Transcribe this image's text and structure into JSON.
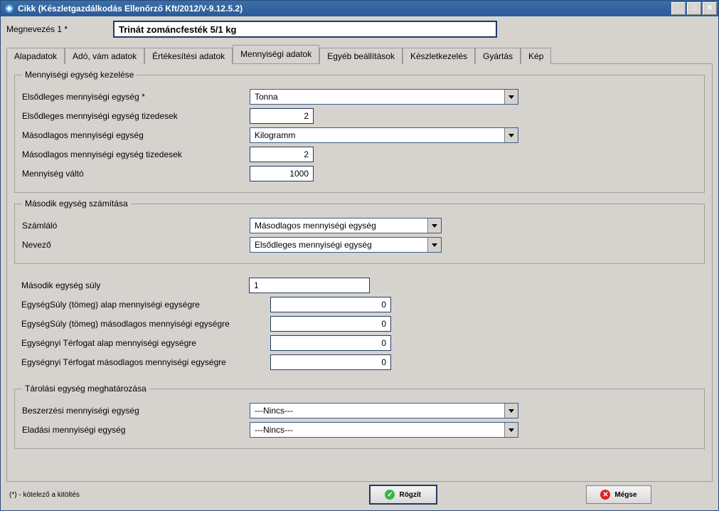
{
  "window": {
    "title": "Cikk (Készletgazdálkodás Ellenőrző Kft/2012/V-9.12.5.2)"
  },
  "header": {
    "label": "Megnevezés 1 *",
    "value": "Trinát zománcfesték 5/1 kg"
  },
  "tabs": {
    "items": [
      "Alapadatok",
      "Adó, vám adatok",
      "Értékesítési adatok",
      "Mennyiségi adatok",
      "Egyéb beállítások",
      "Készletkezelés",
      "Gyártás",
      "Kép"
    ],
    "active_index": 3
  },
  "group_unit": {
    "legend": "Mennyiségi egység kezelése",
    "primary_unit_label": "Elsődleges mennyiségi egység *",
    "primary_unit_value": "Tonna",
    "primary_dec_label": "Elsődleges mennyiségi egység tizedesek",
    "primary_dec_value": "2",
    "secondary_unit_label": "Másodlagos mennyiségi egység",
    "secondary_unit_value": "Kilogramm",
    "secondary_dec_label": "Másodlagos mennyiségi egység tizedesek",
    "secondary_dec_value": "2",
    "ratio_label": "Mennyiség váltó",
    "ratio_value": "1000"
  },
  "group_calc": {
    "legend": "Második egység számítása",
    "numerator_label": "Számláló",
    "numerator_value": "Másodlagos mennyiségi egység",
    "denominator_label": "Nevező",
    "denominator_value": "Elsődleges mennyiségi egység"
  },
  "weights": {
    "second_weight_label": "Második egység súly",
    "second_weight_value": "1",
    "uw_base_label": "EgységSúly (tömeg) alap mennyiségi egységre",
    "uw_base_value": "0",
    "uw_sec_label": "EgységSúly (tömeg) másodlagos mennyiségi egységre",
    "uw_sec_value": "0",
    "uv_base_label": "Egységnyi Térfogat alap mennyiségi egységre",
    "uv_base_value": "0",
    "uv_sec_label": "Egységnyi Térfogat másodlagos mennyiségi egységre",
    "uv_sec_value": "0"
  },
  "group_storage": {
    "legend": "Tárolási egység meghatározása",
    "purchase_label": "Beszerzési mennyiségi egység",
    "purchase_value": "---Nincs---",
    "sale_label": "Eladási mennyiségi egység",
    "sale_value": "---Nincs---"
  },
  "footer": {
    "note": "(*) - kötelező a kitöltés",
    "save": "Rögzít",
    "cancel": "Mégse"
  }
}
